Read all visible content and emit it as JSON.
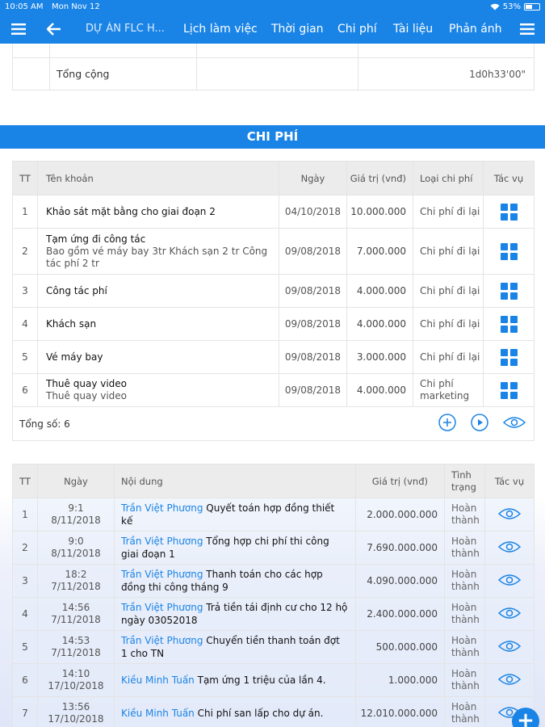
{
  "status_bar": {
    "time": "10:05 AM",
    "date": "Mon Nov 12",
    "battery": "53%",
    "battery_level": 0.53
  },
  "nav": {
    "title": "DỰ ÁN FLC H...",
    "tabs": [
      "Lịch làm việc",
      "Thời gian",
      "Chi phí",
      "Tài liệu",
      "Phản ánh"
    ]
  },
  "time_table": {
    "total_label": "Tổng cộng",
    "total_value": "1d0h33'00\""
  },
  "cost_section": {
    "title": "CHI PHÍ",
    "headers": {
      "tt": "TT",
      "name": "Tên khoản",
      "date": "Ngày",
      "value": "Giá trị (vnđ)",
      "type": "Loại chi phí",
      "action": "Tác vụ"
    },
    "rows": [
      {
        "tt": "1",
        "name": "Khảo sát mặt bằng cho giai đoạn 2",
        "sub": "",
        "date": "04/10/2018",
        "value": "10.000.000",
        "type": "Chi phí đi lại"
      },
      {
        "tt": "2",
        "name": "Tạm ứng đi công tác",
        "sub": "Bao gồm vé máy bay 3tr Khách sạn 2 tr Công tác phí 2 tr",
        "date": "09/08/2018",
        "value": "7.000.000",
        "type": "Chi phí đi lại"
      },
      {
        "tt": "3",
        "name": "Công tác phí",
        "sub": "",
        "date": "09/08/2018",
        "value": "4.000.000",
        "type": "Chi phí đi lại"
      },
      {
        "tt": "4",
        "name": "Khách sạn",
        "sub": "",
        "date": "09/08/2018",
        "value": "4.000.000",
        "type": "Chi phí đi lại"
      },
      {
        "tt": "5",
        "name": "Vé máy bay",
        "sub": "",
        "date": "09/08/2018",
        "value": "3.000.000",
        "type": "Chi phí đi lại"
      },
      {
        "tt": "6",
        "name": "Thuê quay video",
        "sub": "Thuê quay video",
        "date": "09/08/2018",
        "value": "4.000.000",
        "type": "Chi phí marketing"
      }
    ],
    "total": "Tổng số: 6"
  },
  "payment_section": {
    "headers": {
      "tt": "TT",
      "date": "Ngày",
      "content": "Nội dung",
      "value": "Giá trị (vnđ)",
      "status": "Tình trạng",
      "action": "Tác vụ"
    },
    "rows": [
      {
        "tt": "1",
        "time": "9:1",
        "date": "8/11/2018",
        "who": "Trần Việt Phương",
        "text": " Quyết toán hợp đồng thiết kế",
        "value": "2.000.000.000",
        "status": "Hoàn thành"
      },
      {
        "tt": "2",
        "time": "9:0",
        "date": "8/11/2018",
        "who": "Trần Việt Phương",
        "text": " Tổng hợp chi phí thi công giai đoạn 1",
        "value": "7.690.000.000",
        "status": "Hoàn thành"
      },
      {
        "tt": "3",
        "time": "18:2",
        "date": "7/11/2018",
        "who": "Trần Việt Phương",
        "text": " Thanh toán cho các hợp đồng thi công tháng 9",
        "value": "4.090.000.000",
        "status": "Hoàn thành"
      },
      {
        "tt": "4",
        "time": "14:56",
        "date": "7/11/2018",
        "who": "Trần Việt Phương",
        "text": " Trả tiền tái định cư cho 12 hộ ngày 03052018",
        "value": "2.400.000.000",
        "status": "Hoàn thành"
      },
      {
        "tt": "5",
        "time": "14:53",
        "date": "7/11/2018",
        "who": "Trần Việt Phương",
        "text": " Chuyển tiền thanh toán đợt 1 cho TN",
        "value": "500.000.000",
        "status": "Hoàn thành"
      },
      {
        "tt": "6",
        "time": "14:10",
        "date": "17/10/2018",
        "who": "Kiều Minh Tuấn",
        "text": " Tạm ứng 1 triệu của lần 4.",
        "value": "1.000.000",
        "status": "Hoàn thành"
      },
      {
        "tt": "7",
        "time": "13:56",
        "date": "17/10/2018",
        "who": "Kiều Minh Tuấn",
        "text": " Chi phí san lấp cho dự án.",
        "value": "12.010.000.000",
        "status": "Hoàn thành"
      }
    ]
  },
  "colors": {
    "accent": "#1a84e6"
  }
}
